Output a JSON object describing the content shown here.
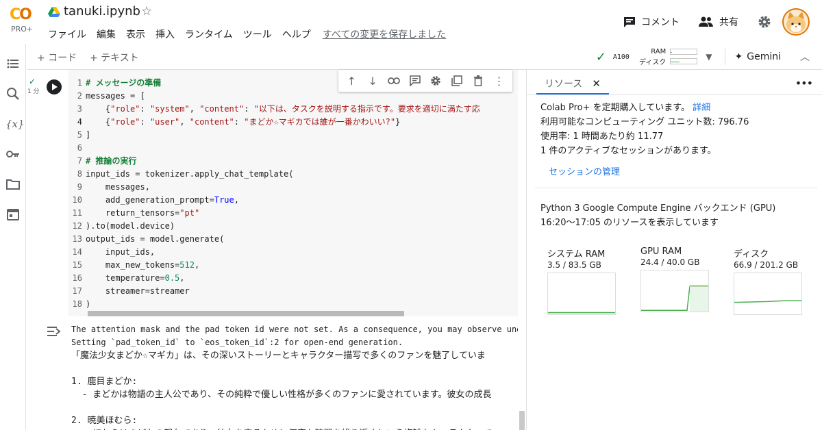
{
  "app": {
    "logo_text": "CO",
    "plan_badge": "PRO+",
    "notebook_title": "tanuki.ipynb",
    "saved_status": "すべての変更を保存しました"
  },
  "menu": [
    "ファイル",
    "編集",
    "表示",
    "挿入",
    "ランタイム",
    "ツール",
    "ヘルプ"
  ],
  "header": {
    "comment_label": "コメント",
    "share_label": "共有"
  },
  "toolbar": {
    "add_code": "+ コード",
    "add_text": "+ テキスト",
    "runtime": "A100",
    "ram_label": "RAM",
    "disk_label": "ディスク",
    "ram_fraction": 0.042,
    "disk_fraction": 0.33,
    "gemini_label": "Gemini"
  },
  "cell": {
    "exec_time": "1 分",
    "lines": [
      {
        "n": "1",
        "html": "<span class=\"cm\"># メッセージの準備</span>"
      },
      {
        "n": "2",
        "html": "messages = ["
      },
      {
        "n": "3",
        "html": "    {<span class=\"st\">\"role\"</span>: <span class=\"st\">\"system\"</span>, <span class=\"st\">\"content\"</span>: <span class=\"st\">\"以下は、タスクを説明する指示です。要求を適切に満たす応</span>"
      },
      {
        "n": "4",
        "html": "    {<span class=\"st\">\"role\"</span>: <span class=\"st\">\"user\"</span>, <span class=\"st\">\"content\"</span>: <span class=\"st\">\"まどか☆マギカでは誰が一番かわいい?\"</span>}"
      },
      {
        "n": "5",
        "html": "]"
      },
      {
        "n": "6",
        "html": ""
      },
      {
        "n": "7",
        "html": "<span class=\"cm\"># 推論の実行</span>"
      },
      {
        "n": "8",
        "html": "input_ids = tokenizer.apply_chat_template("
      },
      {
        "n": "9",
        "html": "    messages,"
      },
      {
        "n": "10",
        "html": "    add_generation_prompt=<span class=\"kw\">True</span>,"
      },
      {
        "n": "11",
        "html": "    return_tensors=<span class=\"st\">\"pt\"</span>"
      },
      {
        "n": "12",
        "html": ").to(model.device)"
      },
      {
        "n": "13",
        "html": "output_ids = model.generate("
      },
      {
        "n": "14",
        "html": "    input_ids,"
      },
      {
        "n": "15",
        "html": "    max_new_tokens=<span class=\"nm\">512</span>,"
      },
      {
        "n": "16",
        "html": "    temperature=<span class=\"nm\">0.5</span>,"
      },
      {
        "n": "17",
        "html": "    streamer=streamer"
      },
      {
        "n": "18",
        "html": ")"
      }
    ]
  },
  "output": {
    "lines": [
      {
        "cls": "mono",
        "text": "The attention mask and the pad token id were not set. As a consequence, you may observe unexp"
      },
      {
        "cls": "mono",
        "text": "Setting `pad_token_id` to `eos_token_id`:2 for open-end generation."
      },
      {
        "cls": "jp",
        "text": "「魔法少女まどか☆マギカ」は、その深いストーリーとキャラクター描写で多くのファンを魅了していま"
      },
      {
        "cls": "jp",
        "text": ""
      },
      {
        "cls": "jp",
        "text": "1. 鹿目まどか:"
      },
      {
        "cls": "jp",
        "text": "  - まどかは物語の主人公であり、その純粋で優しい性格が多くのファンに愛されています。彼女の成長"
      },
      {
        "cls": "jp",
        "text": ""
      },
      {
        "cls": "jp",
        "text": "2. 暁美ほむら:"
      },
      {
        "cls": "jp",
        "text": "  - ほむらはまどかの親友であり、彼女を守るために何度も時間を繰り返すという複雑なキャラクターで"
      }
    ]
  },
  "panel": {
    "tab_label": "リソース",
    "plan_line": "Colab Pro+ を定期購入しています。",
    "plan_link": "詳細",
    "units_line": "利用可能なコンピューティング ユニット数: 796.76",
    "usage_line": "使用率: 1 時間あたり約 11.77",
    "sessions_line": "1 件のアクティブなセッションがあります。",
    "manage_link": "セッションの管理",
    "backend_line": "Python 3 Google Compute Engine バックエンド (GPU)",
    "range_line": "16:20〜17:05 のリソースを表示しています",
    "gauges": [
      {
        "name": "システム RAM",
        "value": "3.5 / 83.5 GB",
        "fraction": 0.042
      },
      {
        "name": "GPU RAM",
        "value": "24.4 / 40.0 GB",
        "fraction": 0.61
      },
      {
        "name": "ディスク",
        "value": "66.9 / 201.2 GB",
        "fraction": 0.33
      }
    ]
  },
  "colors": {
    "accent": "#1a73e8",
    "success": "#188038",
    "gauge_line": "#4caf50",
    "gpu_spike": "#f29900"
  }
}
